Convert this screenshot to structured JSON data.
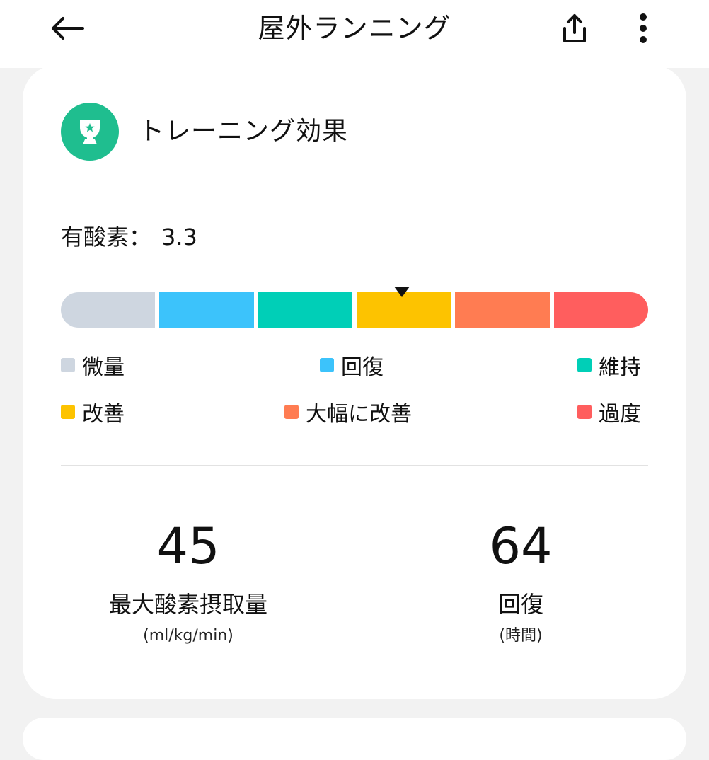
{
  "header": {
    "title": "屋外ランニング",
    "back_icon": "back-arrow-icon",
    "share_icon": "share-icon",
    "more_icon": "more-vertical-icon"
  },
  "training_effect": {
    "title": "トレーニング効果",
    "icon": "trophy-icon",
    "aerobic_label": "有酸素：",
    "aerobic_value": "3.3",
    "gauge_level": 3.3,
    "segments": [
      {
        "label": "微量",
        "color": "#ced6e0"
      },
      {
        "label": "回復",
        "color": "#3cc3fb"
      },
      {
        "label": "維持",
        "color": "#00cfb7"
      },
      {
        "label": "改善",
        "color": "#fdc300"
      },
      {
        "label": "大幅に改善",
        "color": "#ff7c52"
      },
      {
        "label": "過度",
        "color": "#ff5e5e"
      }
    ]
  },
  "stats": [
    {
      "value": "45",
      "label": "最大酸素摂取量",
      "unit": "(ml/kg/min)"
    },
    {
      "value": "64",
      "label": "回復",
      "unit": "(時間)"
    }
  ]
}
